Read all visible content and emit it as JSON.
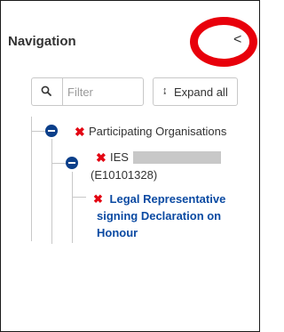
{
  "panel": {
    "title": "Navigation",
    "collapse_glyph": "<"
  },
  "search": {
    "placeholder": "Filter",
    "icon": "search-icon"
  },
  "expand_button": {
    "icon": "↨",
    "label": "Expand all"
  },
  "tree": {
    "root": {
      "status_icon": "✖",
      "label": "Participating Organisations",
      "toggle_icon": "minus-circle-icon"
    },
    "organisation": {
      "status_icon": "✖",
      "name": "IES",
      "id_text": "(E10101328)",
      "toggle_icon": "minus-circle-icon"
    },
    "document": {
      "status_icon": "✖",
      "label": "Legal Representative signing Declaration on Honour"
    }
  },
  "colors": {
    "accent": "#0b3f8a",
    "link": "#0b4aa2",
    "error": "#e30613",
    "annotation_ring": "#e8000b"
  }
}
